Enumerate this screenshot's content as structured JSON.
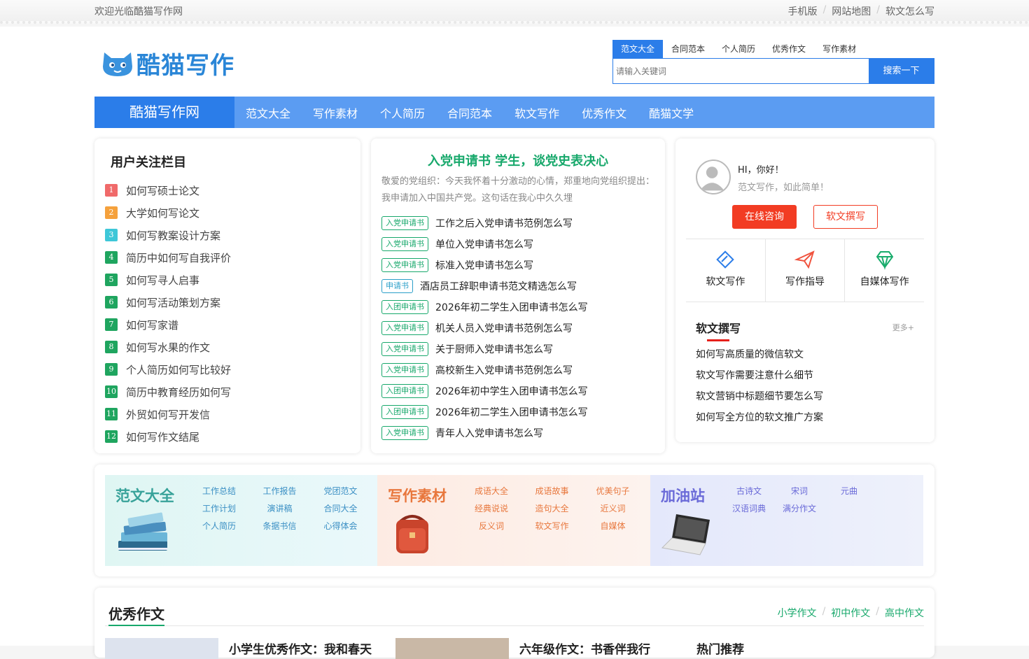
{
  "topbar": {
    "welcome": "欢迎光临酷猫写作网",
    "links": [
      "手机版",
      "网站地图",
      "软文怎么写"
    ],
    "separator": "/"
  },
  "logo": {
    "text": "酷猫写作"
  },
  "search": {
    "tabs": [
      "范文大全",
      "合同范本",
      "个人简历",
      "优秀作文",
      "写作素材"
    ],
    "active_tab": "范文大全",
    "placeholder": "请输入关键词",
    "button": "搜索一下"
  },
  "nav": {
    "brand": "酷猫写作网",
    "items": [
      "范文大全",
      "写作素材",
      "个人简历",
      "合同范本",
      "软文写作",
      "优秀作文",
      "酷猫文学"
    ]
  },
  "left_card": {
    "title": "用户关注栏目",
    "items": [
      {
        "num": "1",
        "label": "如何写硕士论文",
        "color": "#f06a6a"
      },
      {
        "num": "2",
        "label": "大学如何写论文",
        "color": "#f5a13c"
      },
      {
        "num": "3",
        "label": "如何写教案设计方案",
        "color": "#3ec7d8"
      },
      {
        "num": "4",
        "label": "简历中如何写自我评价",
        "color": "#1fa55f"
      },
      {
        "num": "5",
        "label": "如何写寻人启事",
        "color": "#1fa55f"
      },
      {
        "num": "6",
        "label": "如何写活动策划方案",
        "color": "#1fa55f"
      },
      {
        "num": "7",
        "label": "如何写家谱",
        "color": "#1fa55f"
      },
      {
        "num": "8",
        "label": "如何写水果的作文",
        "color": "#1fa55f"
      },
      {
        "num": "9",
        "label": "个人简历如何写比较好",
        "color": "#1fa55f"
      },
      {
        "num": "10",
        "label": "简历中教育经历如何写",
        "color": "#1fa55f"
      },
      {
        "num": "11",
        "label": "外贸如何写开发信",
        "color": "#1fa55f"
      },
      {
        "num": "12",
        "label": "如何写作文结尾",
        "color": "#1fa55f"
      }
    ]
  },
  "center_card": {
    "title": "入党申请书 学生，谈党史表决心",
    "description": "敬爱的党组织：今天我怀着十分激动的心情，郑重地向党组织提出：我申请加入中国共产党。这句话在我心中久久埋",
    "items": [
      {
        "tag": "入党申请书",
        "title": "工作之后入党申请书范例怎么写"
      },
      {
        "tag": "入党申请书",
        "title": "单位入党申请书怎么写"
      },
      {
        "tag": "入党申请书",
        "title": "标准入党申请书怎么写"
      },
      {
        "tag": "申请书",
        "title": "酒店员工辞职申请书范文精选怎么写"
      },
      {
        "tag": "入团申请书",
        "title": "2026年初二学生入团申请书怎么写"
      },
      {
        "tag": "入党申请书",
        "title": "机关人员入党申请书范例怎么写"
      },
      {
        "tag": "入党申请书",
        "title": "关于厨师入党申请书怎么写"
      },
      {
        "tag": "入党申请书",
        "title": "高校新生入党申请书范例怎么写"
      },
      {
        "tag": "入团申请书",
        "title": "2026年初中学生入团申请书怎么写"
      },
      {
        "tag": "入团申请书",
        "title": "2026年初二学生入团申请书怎么写"
      },
      {
        "tag": "入党申请书",
        "title": "青年人入党申请书怎么写"
      }
    ]
  },
  "right_card": {
    "greeting": "HI，你好！",
    "slogan": "范文写作，如此简单！",
    "btn_consult": "在线咨询",
    "btn_write": "软文撰写",
    "shortcuts": [
      {
        "label": "软文写作",
        "icon": "diamond-tag-icon"
      },
      {
        "label": "写作指导",
        "icon": "paper-plane-icon"
      },
      {
        "label": "自媒体写作",
        "icon": "gem-icon"
      }
    ],
    "section_title": "软文撰写",
    "more": "更多+",
    "articles": [
      "如何写高质量的微信软文",
      "软文写作需要注意什么细节",
      "软文营销中标题细节要怎么写",
      "如何写全方位的软文推广方案"
    ]
  },
  "categories": [
    {
      "title": "范文大全",
      "links": [
        "工作总结",
        "工作报告",
        "党团范文",
        "工作计划",
        "演讲稿",
        "合同大全",
        "个人简历",
        "条据书信",
        "心得体会"
      ],
      "icon": "books-icon"
    },
    {
      "title": "写作素材",
      "links": [
        "成语大全",
        "成语故事",
        "优美句子",
        "经典说说",
        "造句大全",
        "近义词",
        "反义词",
        "软文写作",
        "自媒体"
      ],
      "icon": "schoolbag-icon"
    },
    {
      "title": "加油站",
      "links": [
        "古诗文",
        "宋词",
        "元曲",
        "汉语词典",
        "满分作文"
      ],
      "icon": "laptop-icon"
    }
  ],
  "essays": {
    "title": "优秀作文",
    "subnav": [
      "小学作文",
      "初中作文",
      "高中作文"
    ],
    "article1": "小学生优秀作文：我和春天",
    "article2": "六年级作文：书香伴我行",
    "hot": "热门推荐"
  }
}
